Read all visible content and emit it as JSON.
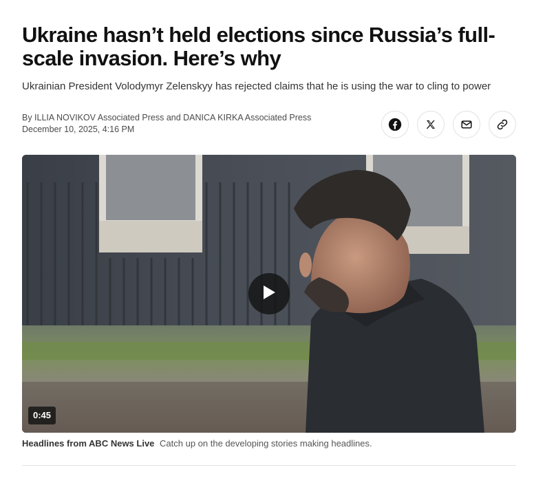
{
  "article": {
    "headline": "Ukraine hasn’t held elections since Russia’s full-scale invasion. Here’s why",
    "subheadline": "Ukrainian President Volodymyr Zelenskyy has rejected claims that he is using the war to cling to power",
    "byline": "By ILLIA NOVIKOV Associated Press and DANICA KIRKA Associated Press",
    "dateline": "December 10, 2025, 4:16 PM"
  },
  "share": {
    "buttons": [
      {
        "icon": "facebook-icon"
      },
      {
        "icon": "x-icon"
      },
      {
        "icon": "mail-icon"
      },
      {
        "icon": "link-icon"
      }
    ]
  },
  "video": {
    "duration": "0:45",
    "progress": 0,
    "caption_title": "Headlines from ABC News Live",
    "caption_text": "Catch up on the developing stories making headlines."
  },
  "colors": {
    "text": "#111111",
    "muted": "#555555",
    "overlay": "#141414"
  }
}
